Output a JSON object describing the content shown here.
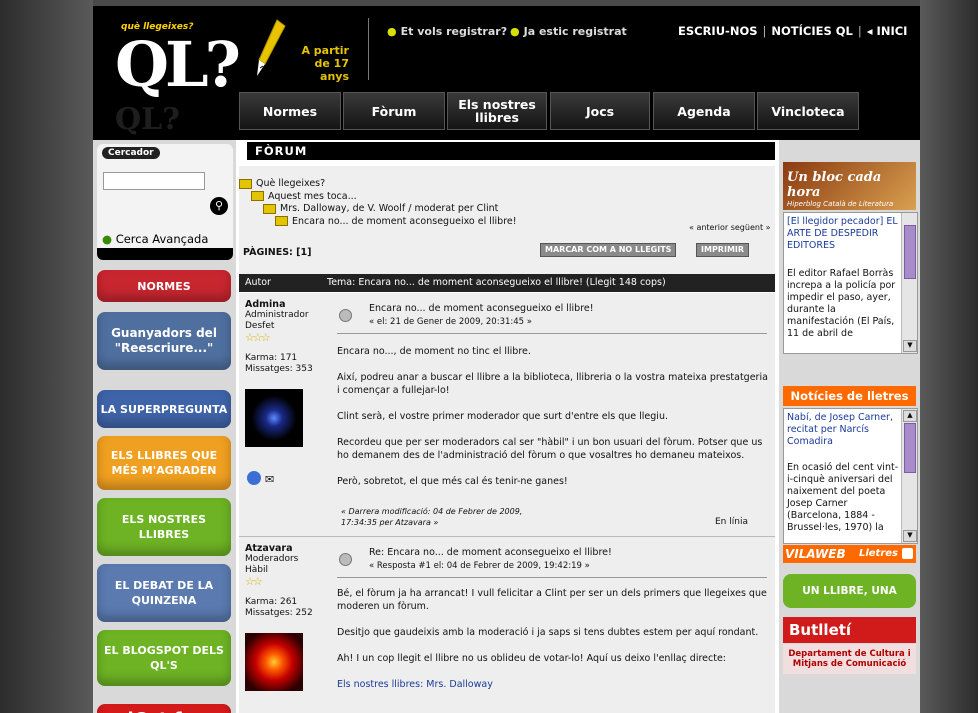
{
  "header": {
    "logo_top": "què llegeixes?",
    "logo": "QL?",
    "age_line1": "A partir",
    "age_line2": "de 17 anys",
    "register": "Et vols registrar?",
    "already": "Ja estic registrat",
    "top_links": [
      "ESCRIU-NOS",
      "NOTÍCIES QL",
      "◂ INICI"
    ],
    "nav": [
      "Normes",
      "Fòrum",
      "Els nostres llibres",
      "Jocs",
      "Agenda",
      "Vincloteca"
    ]
  },
  "search": {
    "label": "Cercador",
    "advanced": "Cerca Avançada"
  },
  "left_buttons": [
    {
      "label": "NORMES",
      "color": "#c8262f"
    },
    {
      "label": "Guanyadors del \"Reescriure...\"",
      "color": "#4f6f9f"
    },
    {
      "label": "LA SUPERPREGUNTA",
      "color": "#3f63a8"
    },
    {
      "label": "ELS LLIBRES QUE MÉS M'AGRADEN",
      "color": "#f0a020"
    },
    {
      "label": "ELS NOSTRES LLIBRES",
      "color": "#6db324"
    },
    {
      "label": "EL DEBAT DE LA QUINZENA",
      "color": "#5a7ab0"
    },
    {
      "label": "EL BLOGSPOT DELS QL'S",
      "color": "#6db324"
    },
    {
      "label": "iCat fm",
      "color": "#d61a1a"
    }
  ],
  "forum": {
    "title": "FÒRUM",
    "breadcrumbs": [
      "Què llegeixes?",
      "Aquest mes toca...",
      "Mrs. Dalloway, de V. Woolf / moderat per Clint",
      "Encara no... de moment aconsegueixo el llibre!"
    ],
    "prevnext": "« anterior següent »",
    "pages": "PÀGINES: [1]",
    "mark_unread": "MARCAR COM A NO LLEGITS",
    "print": "IMPRIMIR",
    "col_author": "Autor",
    "col_topic": "Tema: Encara no... de moment aconsegueixo el llibre!  (Llegit 148 cops)"
  },
  "posts": [
    {
      "author": "Admina",
      "role": "Administrador",
      "status": "Desfet",
      "karma": "Karma: 171",
      "messages": "Missatges: 353",
      "title": "Encara no... de moment aconsegueixo el llibre!",
      "date": "« el: 21 de Gener de 2009, 20:31:45 »",
      "paragraphs": [
        "Encara no..., de moment no tinc el llibre.",
        "Així, podreu anar a buscar el llibre a la biblioteca, llibreria o la vostra mateixa prestatgeria i començar a fullejar-lo!",
        "Clint serà, el vostre primer moderador que surt d'entre els que llegiu.",
        "Recordeu que per ser moderadors cal ser \"hàbil\" i un bon usuari del fòrum. Potser que us ho demanem des de l'administració del fòrum o que vosaltres ho demaneu mateixos.",
        "Però, sobretot, el que més cal és tenir-ne ganes!"
      ],
      "modified": "« Darrera modificació: 04 de Febrer de 2009, 17:34:35 per Atzavara »",
      "ip": "En línia"
    },
    {
      "author": "Atzavara",
      "role": "Moderadors",
      "status": "Hàbil",
      "karma": "Karma: 261",
      "messages": "Missatges: 252",
      "title": "Re: Encara no... de moment aconsegueixo el llibre!",
      "date": "« Resposta #1 el: 04 de Febrer de 2009, 19:42:19 »",
      "paragraphs": [
        "Bé, el fòrum ja ha arrancat! I vull felicitar a Clint per ser un dels primers que llegeixes que moderen un fòrum.",
        "Desitjo que gaudeixis amb la moderació i ja saps si tens dubtes estem per aquí rondant.",
        "Ah! I un cop llegit el llibre no us oblideu de votar-lo! Aquí us deixo l'enllaç directe:"
      ],
      "link": "Els nostres llibres: Mrs. Dalloway"
    }
  ],
  "right": {
    "blog_title": "Un bloc cada hora",
    "blog_sub": "Hiperblog Català de Literatura",
    "blog_link": "[El llegidor pecador] EL ARTE DE DESPEDIR EDITORES",
    "blog_text": "El editor Rafael Borràs increpa a la policía por impedir el paso, ayer, durante la manifestación (El País, 11 de abril de",
    "news_title": "Notícies de lletres",
    "news_link": "Nabí, de Josep Carner, recitat per Narcís Comadira",
    "news_text": "En ocasió del cent vint-i-cinquè aniversari del naixement del poeta Josep Carner (Barcelona, 1884 - Brussel·les, 1970) la",
    "vilaweb": "VILAWEB",
    "lletres": "Lletres",
    "phrase_btn": "UN LLIBRE, UNA FRASE",
    "butlleti": "Butlletí",
    "dept": "Departament de Cultura i Mitjans de Comunicació"
  }
}
